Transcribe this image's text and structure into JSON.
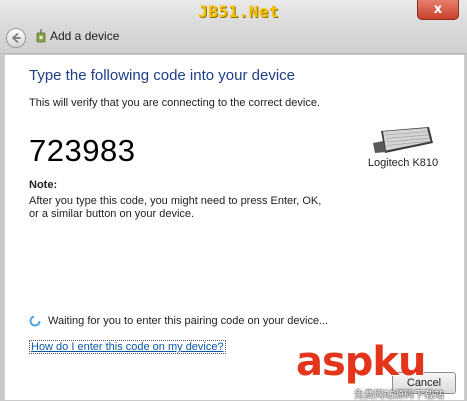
{
  "watermark_top": "JB51.Net",
  "window": {
    "close_glyph": "x",
    "back_icon": "back-arrow-icon",
    "title_icon": "bluetooth-device-icon",
    "title": "Add a device"
  },
  "content": {
    "heading": "Type the following code into your device",
    "subtext": "This will verify that you are connecting to the correct device.",
    "code": "723983",
    "note_label": "Note:",
    "note_text": "After you type this code, you might need to press Enter, OK, or a similar button on your device.",
    "device_name": "Logitech K810",
    "device_icon": "keyboard-icon",
    "waiting_text": "Waiting for you to enter this pairing code on your device...",
    "help_link": "How do I enter this code on my device?"
  },
  "buttons": {
    "cancel": "Cancel"
  },
  "watermark_bottom": {
    "logo": "aspku",
    "sub": "免费网站源码下载站"
  },
  "colors": {
    "heading": "#1f3d85",
    "link": "#0a5aa8",
    "watermark_red": "#e3341c",
    "watermark_gold": "#f7c200"
  }
}
